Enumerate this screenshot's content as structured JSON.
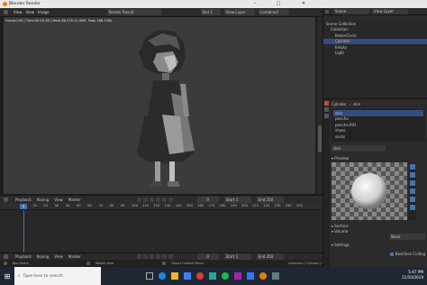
{
  "window": {
    "title": "Blender Render"
  },
  "render_header": {
    "menus": [
      "View",
      "View",
      "Image"
    ],
    "result": "Render Result",
    "slot": "Slot 1",
    "layer": "View Layer",
    "pass": "Combined"
  },
  "render_info": "Frame:250 | Time:00:00.56 | Mem:88.57M (0.00M, Peak 166.12M)",
  "timeline": {
    "menus": [
      "Playback",
      "Keying",
      "View",
      "Marker"
    ],
    "current_frame": "0",
    "start_label": "Start",
    "start": "1",
    "end_label": "End",
    "end": "250",
    "ticks": [
      "0",
      "10",
      "20",
      "30",
      "40",
      "50",
      "60",
      "70",
      "80",
      "90",
      "100",
      "110",
      "120",
      "130",
      "140",
      "150",
      "160",
      "170",
      "180",
      "190",
      "200",
      "210",
      "220",
      "230",
      "240",
      "250"
    ],
    "playhead": "0"
  },
  "timeline2": {
    "menus": [
      "Playback",
      "Keying",
      "View",
      "Marker"
    ],
    "current_frame": "0",
    "start_label": "Start",
    "start": "1",
    "end_label": "End",
    "end": "250"
  },
  "status": {
    "left": "Box Select",
    "mid": "Rotate View",
    "mid2": "Object Context Menu",
    "right": "Collection | Cylinder | Verts:1,443 | Faces:1,355 | Tris:3,002 | Objects:1/6 | Mem:"
  },
  "taskbar": {
    "search_placeholder": "Type here to search",
    "time": "5:47 PM",
    "date": "11/10/2019"
  },
  "right_header": {
    "scene_label": "Scene",
    "view_layer_label": "View Layer"
  },
  "outliner": {
    "items": [
      {
        "label": "Scene Collection",
        "selected": false
      },
      {
        "label": "Collection",
        "selected": false
      },
      {
        "label": "BezierCircle",
        "selected": false
      },
      {
        "label": "Cylinder",
        "selected": true
      },
      {
        "label": "Empty",
        "selected": false
      },
      {
        "label": "Light",
        "selected": false
      }
    ]
  },
  "properties": {
    "object": "Cylinder",
    "material": "skin",
    "slots": [
      "skin",
      "poncho",
      "poncho.001",
      "shoes",
      "socks"
    ],
    "material_field": "skin",
    "preview_label": "Preview",
    "surface_label": "Surface",
    "volume_label": "Volume",
    "volume_value": "None",
    "settings_label": "Settings",
    "backface_label": "Backface Culling"
  },
  "colors": {
    "accent": "#4772b3",
    "selected": "#334d80",
    "bg": "#2b2b2b",
    "viewport": "#3b3b3b"
  }
}
